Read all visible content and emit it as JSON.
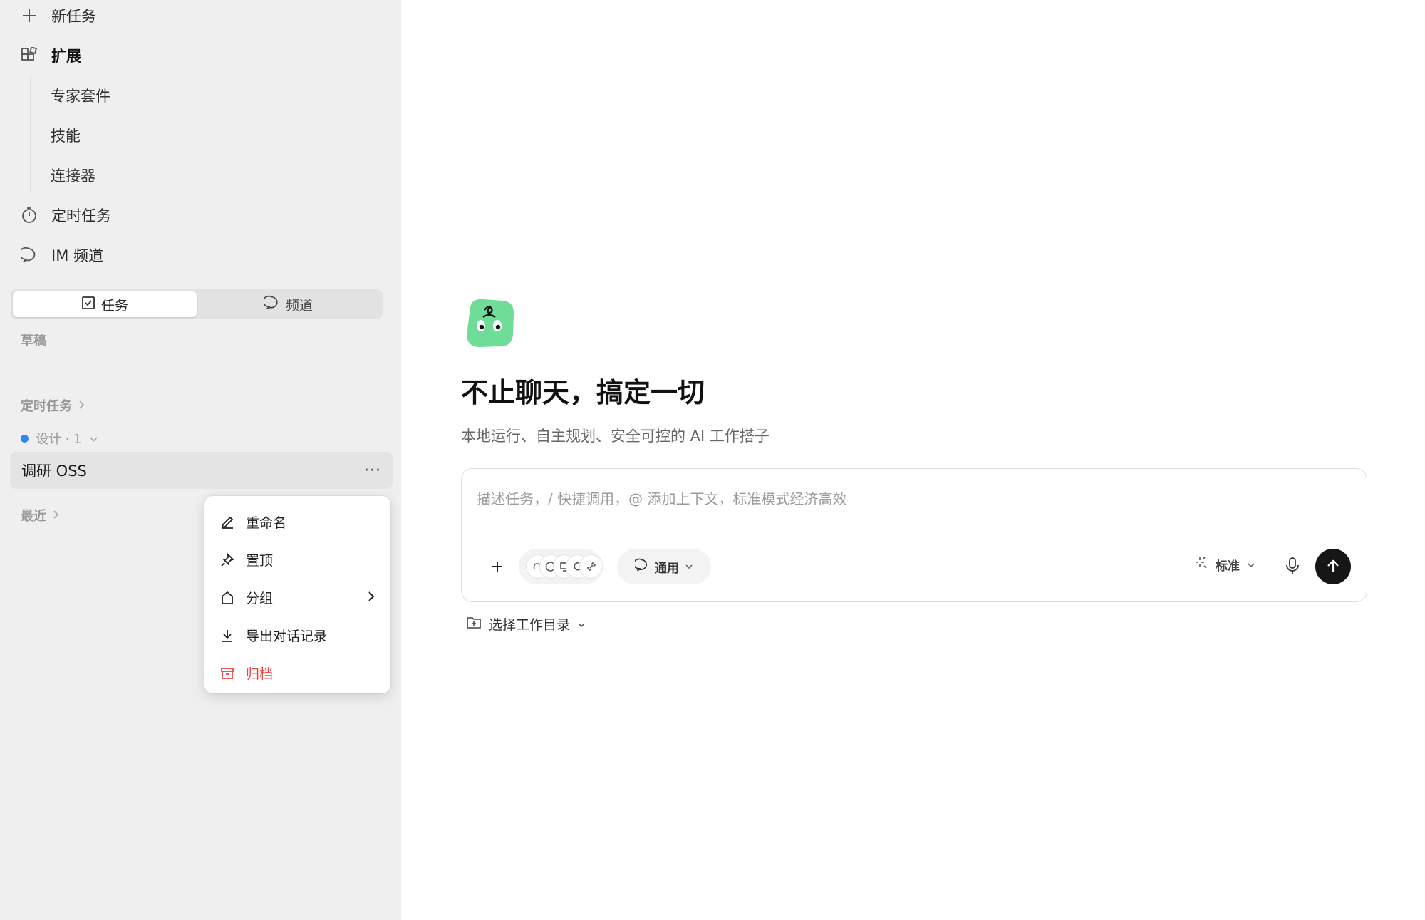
{
  "sidebar": {
    "new_task": "新任务",
    "extensions": "扩展",
    "sub_items": [
      "专家套件",
      "技能",
      "连接器"
    ],
    "scheduled": "定时任务",
    "im_channel": "IM 频道",
    "tabs": [
      {
        "label": "任务",
        "icon": "checkbox-icon",
        "active": true
      },
      {
        "label": "频道",
        "icon": "chat-bubble-icon",
        "active": false
      }
    ],
    "drafts_label": "草稿",
    "scheduled_section_label": "定时任务",
    "group_label": "设计 · 1",
    "group_color": "#2f86f6",
    "selected_task": "调研 OSS",
    "recent_label": "最近"
  },
  "context_menu": {
    "items": [
      {
        "label": "重命名",
        "icon": "pencil-icon"
      },
      {
        "label": "置顶",
        "icon": "pin-icon"
      },
      {
        "label": "分组",
        "icon": "group-tag-icon",
        "has_submenu": true
      },
      {
        "label": "导出对话记录",
        "icon": "download-icon"
      },
      {
        "label": "归档",
        "icon": "archive-icon",
        "danger": true
      }
    ],
    "danger_color": "#ef4444"
  },
  "main": {
    "title": "不止聊天，搞定一切",
    "subtitle": "本地运行、自主规划、安全可控的 AI 工作搭子",
    "composer": {
      "placeholder": "描述任务，/ 快捷调用，@ 添加上下文，标准模式经济高效",
      "mode": "通用",
      "quality": "标准"
    },
    "workdir": "选择工作目录",
    "accent_logo": "#6fdc97"
  }
}
